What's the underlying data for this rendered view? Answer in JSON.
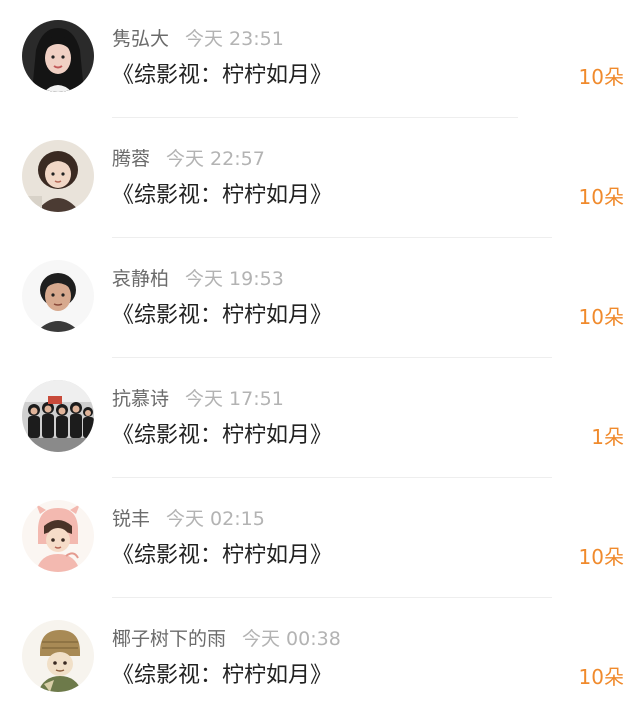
{
  "colors": {
    "accent": "#f08a2c",
    "name": "#6b6b6b",
    "time": "#b3b3b3",
    "title": "#222222"
  },
  "rows": [
    {
      "name": "隽弘大",
      "time": "今天 23:51",
      "title": "《综影视：柠柠如月》",
      "amount": "10朵"
    },
    {
      "name": "腾蓉",
      "time": "今天 22:57",
      "title": "《综影视：柠柠如月》",
      "amount": "10朵"
    },
    {
      "name": "哀静柏",
      "time": "今天 19:53",
      "title": "《综影视：柠柠如月》",
      "amount": "10朵"
    },
    {
      "name": "抗慕诗",
      "time": "今天 17:51",
      "title": "《综影视：柠柠如月》",
      "amount": "1朵"
    },
    {
      "name": "锐丰",
      "time": "今天 02:15",
      "title": "《综影视：柠柠如月》",
      "amount": "10朵"
    },
    {
      "name": "椰子树下的雨",
      "time": "今天 00:38",
      "title": "《综影视：柠柠如月》",
      "amount": "10朵"
    }
  ]
}
